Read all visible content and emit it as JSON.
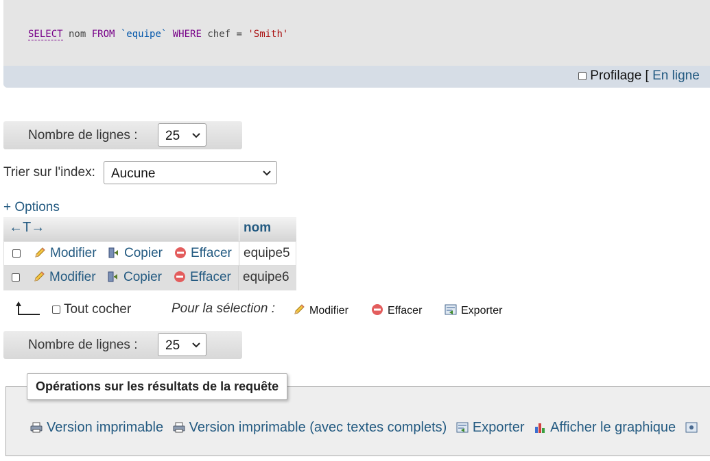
{
  "sql": {
    "select": "SELECT",
    "col": " nom ",
    "from": "FROM",
    "table": " `equipe` ",
    "where": "WHERE",
    "cond": " chef = ",
    "value": "'Smith'"
  },
  "profiling": {
    "label": "Profilage [",
    "link": "En ligne"
  },
  "nav_top": {
    "label": "Nombre de lignes :",
    "selected": "25"
  },
  "sort": {
    "label": "Trier sur l'index:",
    "selected": "Aucune"
  },
  "options_link": "+ Options",
  "table": {
    "header_arrows": "←T→",
    "column": "nom",
    "action_labels": {
      "edit": "Modifier",
      "copy": "Copier",
      "delete": "Effacer"
    },
    "rows": [
      {
        "nom": "equipe5"
      },
      {
        "nom": "equipe6"
      }
    ]
  },
  "bulk": {
    "check_all": "Tout cocher",
    "for_selection": "Pour la sélection :",
    "edit": "Modifier",
    "delete": "Effacer",
    "export": "Exporter"
  },
  "nav_bottom": {
    "label": "Nombre de lignes :",
    "selected": "25"
  },
  "operations": {
    "legend": "Opérations sur les résultats de la requête",
    "links": {
      "print": "Version imprimable",
      "print_full": "Version imprimable (avec textes complets)",
      "export": "Exporter",
      "chart": "Afficher le graphique"
    }
  },
  "colors": {
    "link": "#235a81",
    "sql_keyword": "#770088",
    "sql_string": "#aa1111",
    "sql_backtick": "#0055aa"
  },
  "icons": [
    "pencil-icon",
    "copy-icon",
    "delete-icon",
    "export-icon",
    "print-icon",
    "chart-icon"
  ]
}
